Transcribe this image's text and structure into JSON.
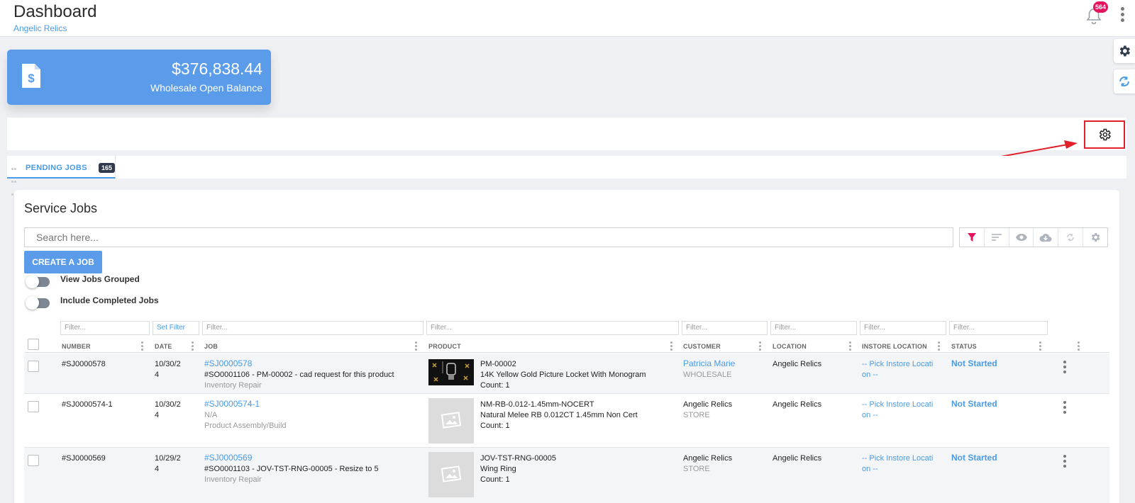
{
  "header": {
    "title": "Dashboard",
    "subtitle": "Angelic Relics",
    "notification_count": "564"
  },
  "balance": {
    "amount": "$376,838.44",
    "label": "Wholesale Open Balance"
  },
  "tabs": [
    {
      "label": "PENDING JOBS",
      "count": "165"
    }
  ],
  "panel": {
    "title": "Service Jobs",
    "search_placeholder": "Search here...",
    "create_button": "CREATE A JOB",
    "toggles": [
      {
        "label": "View Jobs Grouped"
      },
      {
        "label": "Include Completed Jobs"
      }
    ]
  },
  "filters": {
    "placeholder": "Filter...",
    "date_filter": "Set Filter"
  },
  "columns": [
    "NUMBER",
    "DATE",
    "JOB",
    "PRODUCT",
    "CUSTOMER",
    "LOCATION",
    "INSTORE LOCATION",
    "STATUS"
  ],
  "rows": [
    {
      "number": "#SJ0000578",
      "date_line1": "10/30/2",
      "date_line2": "4",
      "job_id": "#SJ0000578",
      "job_desc": "#SO0001106 - PM-00002 - cad request for this product",
      "job_type": "Inventory Repair",
      "product_sku": "PM-00002",
      "product_name": "14K Yellow Gold Picture Locket With Monogram",
      "product_count": "Count: 1",
      "customer_name": "Patricia Marie",
      "customer_type": "WHOLESALE",
      "location": "Angelic Relics",
      "instore_line1": "-- Pick Instore Locati",
      "instore_line2": "on --",
      "status": "Not Started"
    },
    {
      "number": "#SJ0000574-1",
      "date_line1": "10/30/2",
      "date_line2": "4",
      "job_id": "#SJ0000574-1",
      "job_desc": "N/A",
      "job_type": "Product Assembly/Build",
      "product_sku": "NM-RB-0.012-1.45mm-NOCERT",
      "product_name": "Natural Melee RB 0.012CT 1.45mm Non Cert",
      "product_count": "Count: 1",
      "customer_name": "Angelic Relics",
      "customer_type": "STORE",
      "location": "Angelic Relics",
      "instore_line1": "-- Pick Instore Locati",
      "instore_line2": "on --",
      "status": "Not Started"
    },
    {
      "number": "#SJ0000569",
      "date_line1": "10/29/2",
      "date_line2": "4",
      "job_id": "#SJ0000569",
      "job_desc": "#SO0001103 - JOV-TST-RNG-00005 - Resize to 5",
      "job_type": "Inventory Repair",
      "product_sku": "JOV-TST-RNG-00005",
      "product_name": "Wing Ring",
      "product_count": "Count: 1",
      "customer_name": "Angelic Relics",
      "customer_type": "STORE",
      "location": "Angelic Relics",
      "instore_line1": "-- Pick Instore Locati",
      "instore_line2": "on --",
      "status": "Not Started"
    }
  ],
  "icons": {
    "notification": "bell-icon",
    "menu": "kebab-menu-icon",
    "side_settings": "gear-icon",
    "side_refresh": "sync-icon",
    "balance": "invoice-dollar-icon",
    "widget_settings": "gear-outline-icon",
    "toolbar": [
      "filter-icon",
      "sort-icon",
      "eye-icon",
      "cloud-download-icon",
      "refresh-icon",
      "gear-icon"
    ]
  },
  "colors": {
    "accent": "#4a9be6",
    "card": "#5b9cea",
    "badge": "#e5135d",
    "highlight": "#e0202a",
    "filter_active": "#e5135d"
  }
}
